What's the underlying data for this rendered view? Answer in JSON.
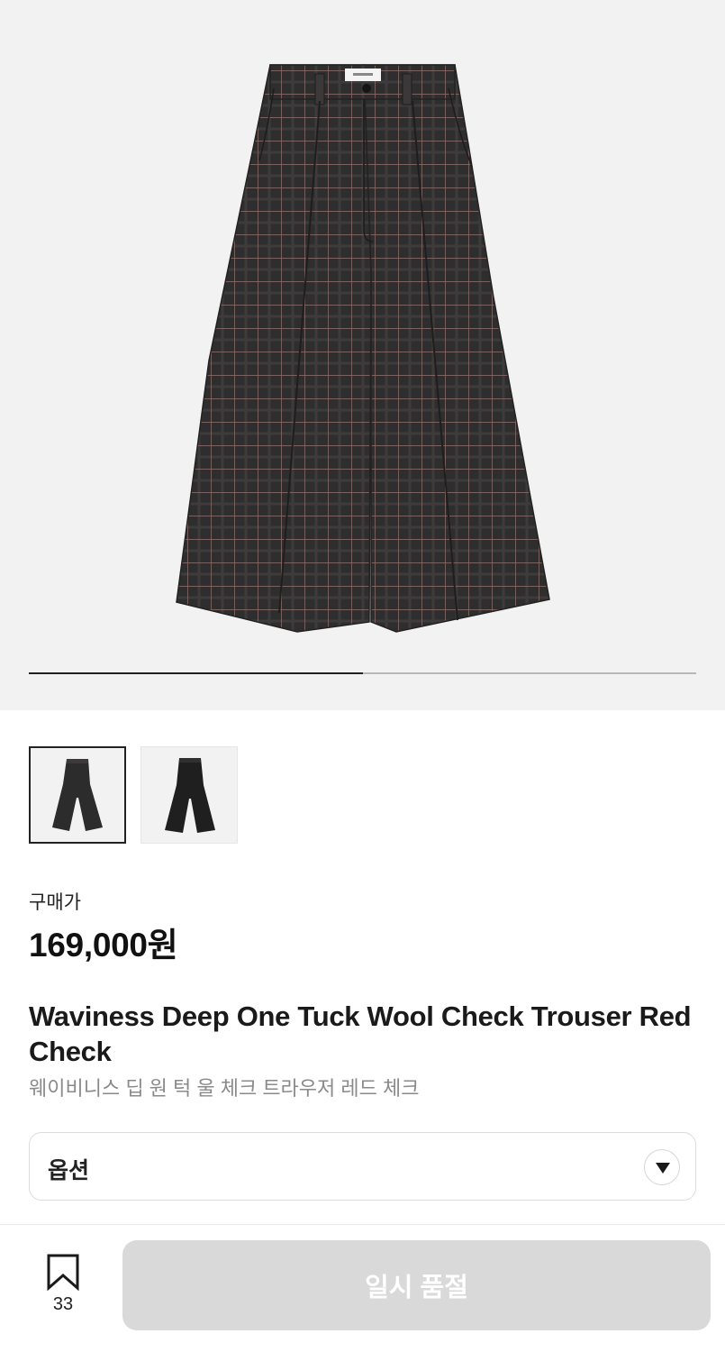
{
  "gallery": {
    "progress_fraction": 0.5,
    "thumbnails": [
      {
        "name": "thumbnail-front",
        "active": true
      },
      {
        "name": "thumbnail-back",
        "active": false
      }
    ]
  },
  "price": {
    "label": "구매가",
    "value": "169,000원"
  },
  "product": {
    "title_en": "Waviness Deep One Tuck Wool Check Trouser Red Check",
    "title_ko": "웨이비니스 딥 원 턱 울 체크 트라우저 레드 체크"
  },
  "option": {
    "label": "옵션",
    "icon": "chevron-down-icon"
  },
  "bottom_bar": {
    "bookmark_icon": "bookmark-icon",
    "bookmark_count": "33",
    "cta_label": "일시 품절"
  },
  "colors": {
    "hero_bg": "#f2f2f2",
    "fabric": "#2f2e2e",
    "check_line": "#8a6b66",
    "cta_disabled": "#d9d9d9"
  }
}
